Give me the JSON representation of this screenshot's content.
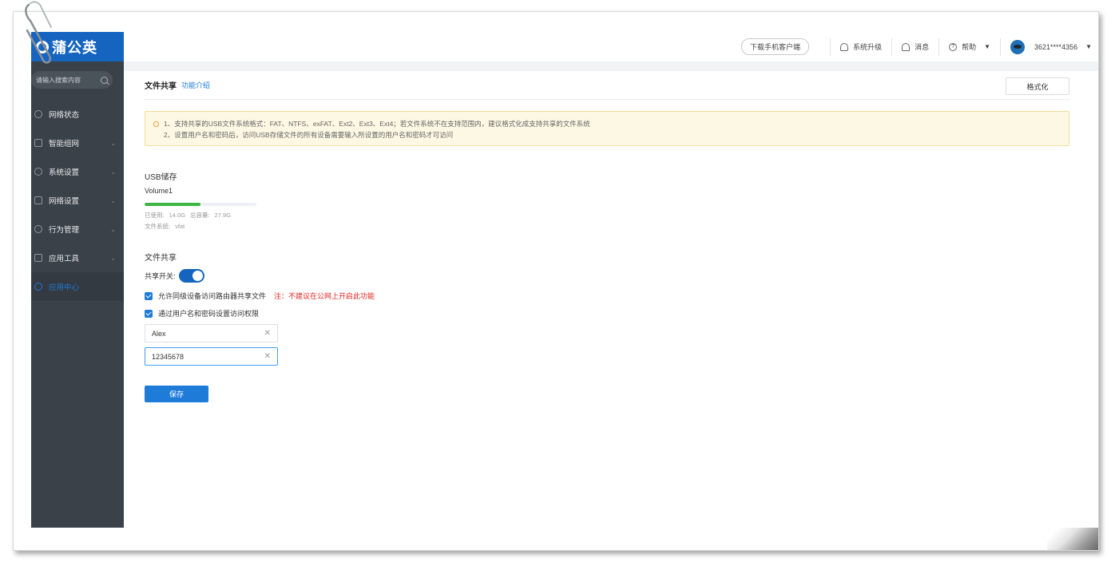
{
  "brand": {
    "logo_text": "蒲公英"
  },
  "sidebar": {
    "search_placeholder": "请输入搜索内容",
    "items": [
      {
        "label": "网络状态"
      },
      {
        "label": "智能组网"
      },
      {
        "label": "系统设置"
      },
      {
        "label": "网络设置"
      },
      {
        "label": "行为管理"
      },
      {
        "label": "应用工具"
      },
      {
        "label": "应用中心"
      }
    ]
  },
  "header": {
    "download_label": "下载手机客户端",
    "upgrade_label": "系统升级",
    "messages_label": "消息",
    "help_label": "帮助",
    "account_label": "3621****4356"
  },
  "page": {
    "title": "文件共享",
    "intro_link": "功能介绍",
    "format_label": "格式化",
    "notice_line1": "1、支持共享的USB文件系统格式：FAT、NTFS、exFAT、Ext2、Ext3、Ext4；若文件系统不在支持范围内，建议格式化成支持共享的文件系统",
    "notice_line2": "2、设置用户名和密码后，访问USB存储文件的所有设备需要输入所设置的用户名和密码才可访问"
  },
  "usb": {
    "section_title": "USB储存",
    "volume_name": "Volume1",
    "used_label": "已使用:",
    "used_value": "14.0G",
    "total_label": "总容量:",
    "total_value": "27.9G",
    "fs_label": "文件系统:",
    "fs_value": "vfat",
    "used_fraction": 0.502
  },
  "sharing": {
    "section_title": "文件共享",
    "switch_label": "共享开关:",
    "switch_on": true,
    "allow_label": "允许同级设备访问路由器共享文件",
    "allow_note": "注：不建议在公网上开启此功能",
    "auth_label": "通过用户名和密码设置访问权限",
    "username_value": "Alex",
    "password_value": "12345678",
    "save_label": "保存"
  },
  "colors": {
    "brand_blue": "#1565c0",
    "sidebar_bg": "#3a4149",
    "usage_green": "#3cb543",
    "warning_red": "#e02424"
  }
}
